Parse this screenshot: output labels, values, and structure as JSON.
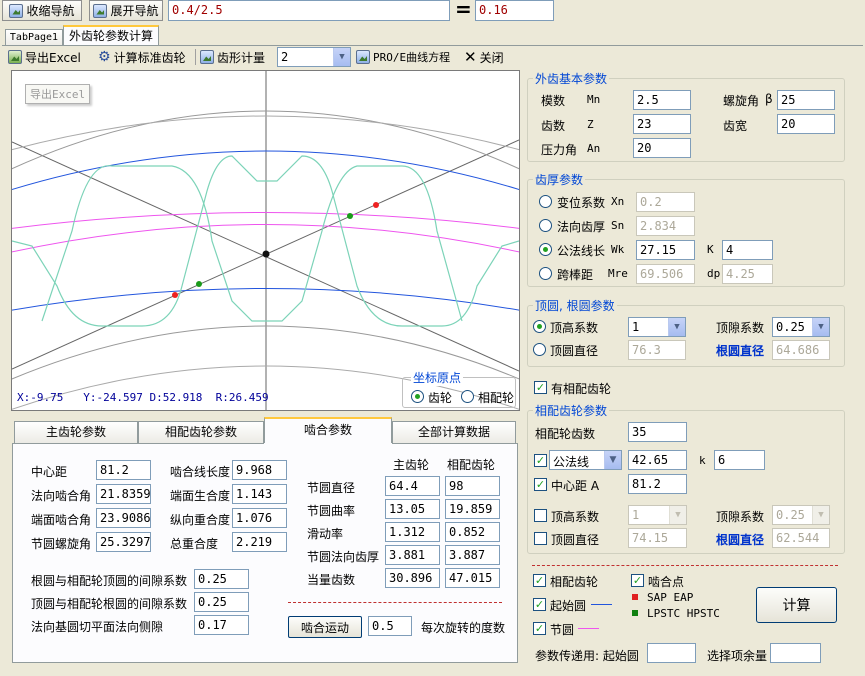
{
  "nav": {
    "collapse": "收缩导航",
    "expand": "展开导航",
    "expr": "0.4/2.5",
    "eq": "=",
    "result": "0.16"
  },
  "tabs": {
    "page1": "TabPage1",
    "page2": "外齿轮参数计算"
  },
  "toolbar": {
    "export": "导出Excel",
    "calc_std": "计算标准齿轮",
    "measure": "齿形计量",
    "measure_val": "2",
    "proe": "PRO/E曲线方程",
    "close": "关闭"
  },
  "plot": {
    "tooltip": "导出Excel",
    "status": "X:-9.75   Y:-24.597 D:52.918  R:26.459",
    "origin_title": "坐标原点",
    "origin_gear": "齿轮",
    "origin_mate": "相配轮"
  },
  "basic": {
    "title": "外齿基本参数",
    "module": "模数",
    "mn": "Mn",
    "mn_val": "2.5",
    "helix": "螺旋角",
    "beta": "β",
    "beta_val": "25",
    "teeth": "齿数",
    "z": "Z",
    "z_val": "23",
    "width": "齿宽",
    "width_val": "20",
    "pressure": "压力角",
    "an": "An",
    "an_val": "20"
  },
  "thick": {
    "title": "齿厚参数",
    "shift": "变位系数",
    "xn": "Xn",
    "xn_val": "0.2",
    "sn_label": "法向齿厚",
    "sn": "Sn",
    "sn_val": "2.834",
    "wk_label": "公法线长",
    "wk": "Wk",
    "wk_val": "27.15",
    "k": "K",
    "k_val": "4",
    "ball": "跨棒距",
    "mre": "Mre",
    "mre_val": "69.506",
    "dp": "dp",
    "dp_val": "4.25"
  },
  "tip": {
    "title": "顶圆, 根圆参数",
    "addendum": "顶高系数",
    "addendum_val": "1",
    "clearance": "顶隙系数",
    "clearance_val": "0.25",
    "tip_dia": "顶圆直径",
    "tip_dia_val": "76.3",
    "root_dia": "根圆直径",
    "root_dia_val": "64.686"
  },
  "has_mate": "有相配齿轮",
  "mate": {
    "title": "相配齿轮参数",
    "teeth": "相配轮齿数",
    "teeth_val": "35",
    "method": "公法线",
    "method_val": "42.65",
    "k": "k",
    "k_val": "6",
    "center": "中心距 A",
    "center_val": "81.2",
    "addendum": "顶高系数",
    "addendum_val": "1",
    "clearance": "顶隙系数",
    "clearance_val": "0.25",
    "tip_dia": "顶圆直径",
    "tip_dia_val": "74.15",
    "root_dia": "根圆直径",
    "root_dia_val": "62.544"
  },
  "opts": {
    "mate_gear": "相配齿轮",
    "mesh_pt": "啮合点",
    "start_circle": "起始圆",
    "sap_eap": "SAP EAP",
    "lpstc": "LPSTC HPSTC",
    "pitch": "节圆",
    "calc": "计算"
  },
  "footer": {
    "pass": "参数传递用: 起始圆",
    "select": "选择项余量"
  },
  "btabs": {
    "t1": "主齿轮参数",
    "t2": "相配齿轮参数",
    "t3": "啮合参数",
    "t4": "全部计算数据"
  },
  "mesh": {
    "center": "中心距",
    "center_val": "81.2",
    "len": "啮合线长度",
    "len_val": "9.968",
    "nangle": "法向啮合角",
    "nangle_val": "21.8359",
    "tratio": "端面生合度",
    "tratio_val": "1.143",
    "tangle": "端面啮合角",
    "tangle_val": "23.9086",
    "oratio": "纵向重合度",
    "oratio_val": "1.076",
    "phelix": "节圆螺旋角",
    "phelix_val": "25.3297",
    "total": "总重合度",
    "total_val": "2.219",
    "col_main": "主齿轮",
    "col_mate": "相配齿轮",
    "pd": "节圆直径",
    "pd_a": "64.4",
    "pd_b": "98",
    "pc": "节圆曲率",
    "pc_a": "13.05",
    "pc_b": "19.859",
    "slip": "滑动率",
    "slip_a": "1.312",
    "slip_b": "0.852",
    "pth": "节圆法向齿厚",
    "pth_a": "3.881",
    "pth_b": "3.887",
    "eqz": "当量齿数",
    "eqz_a": "30.896",
    "eqz_b": "47.015",
    "c1": "根圆与相配轮顶圆的间隙系数",
    "c1_val": "0.25",
    "c2": "顶圆与相配轮根圆的间隙系数",
    "c2_val": "0.25",
    "c3": "法向基圆切平面法向侧隙",
    "c3_val": "0.17",
    "motion": "啮合运动",
    "deg_val": "0.5",
    "deg": "每次旋转的度数"
  }
}
